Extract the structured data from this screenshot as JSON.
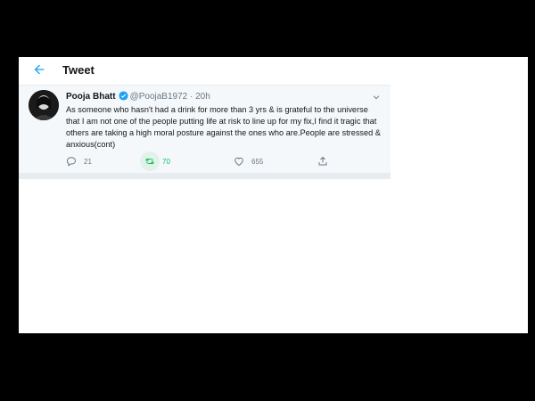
{
  "header": {
    "title": "Tweet"
  },
  "tweet": {
    "display_name": "Pooja Bhatt",
    "handle": "@PoojaB1972",
    "separator": "·",
    "time": "20h",
    "text": "As someone who hasn't had a drink for more than 3 yrs & is grateful to the universe that I am not one of the people putting life at risk to line up for my fix,I find it tragic that others are taking a high moral posture against the ones who are.People are stressed & anxious(cont)",
    "replies": "21",
    "retweets": "70",
    "likes": "655"
  },
  "colors": {
    "accent": "#1da1f2",
    "retweet_active": "#17bf63",
    "muted": "#657786",
    "text": "#14171a"
  },
  "icons": [
    "back-arrow-icon",
    "verified-icon",
    "chevron-down-icon",
    "reply-icon",
    "retweet-icon",
    "like-icon",
    "share-icon"
  ]
}
